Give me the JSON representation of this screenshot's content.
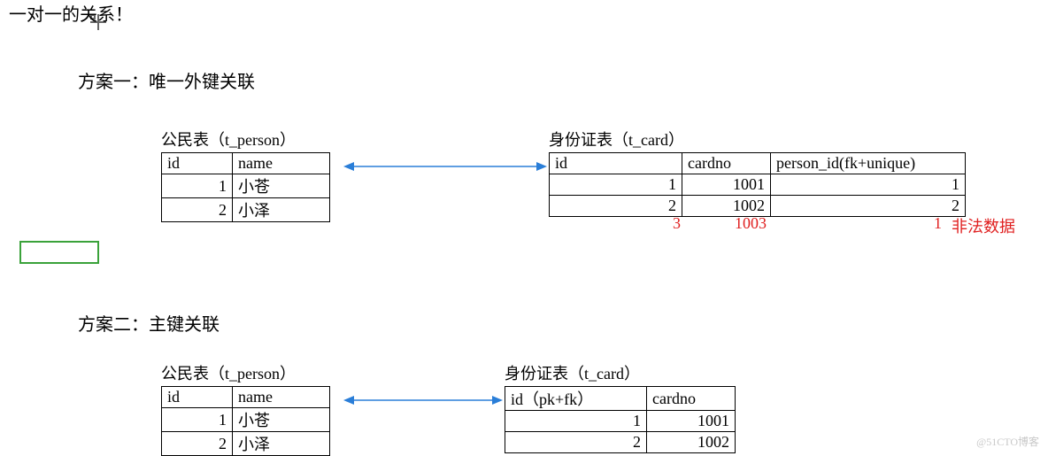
{
  "title": "一对一的关系！",
  "watermark": "@51CTO博客",
  "section1": {
    "title": "方案一：唯一外键关联",
    "person": {
      "caption": "公民表（t_person）",
      "cols": [
        "id",
        "name"
      ],
      "rows": [
        {
          "id": "1",
          "name": "小苍"
        },
        {
          "id": "2",
          "name": "小泽"
        }
      ]
    },
    "card": {
      "caption": "身份证表（t_card）",
      "cols": [
        "id",
        "cardno",
        "person_id(fk+unique)"
      ],
      "rows": [
        {
          "id": "1",
          "cardno": "1001",
          "pid": "1"
        },
        {
          "id": "2",
          "cardno": "1002",
          "pid": "2"
        }
      ],
      "illegal": {
        "id": "3",
        "cardno": "1003",
        "pid": "1",
        "note": "非法数据"
      }
    }
  },
  "section2": {
    "title": "方案二：主键关联",
    "person": {
      "caption": "公民表（t_person）",
      "cols": [
        "id",
        "name"
      ],
      "rows": [
        {
          "id": "1",
          "name": "小苍"
        },
        {
          "id": "2",
          "name": "小泽"
        }
      ]
    },
    "card": {
      "caption": "身份证表（t_card）",
      "cols": [
        "id（pk+fk）",
        "cardno"
      ],
      "rows": [
        {
          "id": "1",
          "cardno": "1001"
        },
        {
          "id": "2",
          "cardno": "1002"
        }
      ]
    }
  }
}
